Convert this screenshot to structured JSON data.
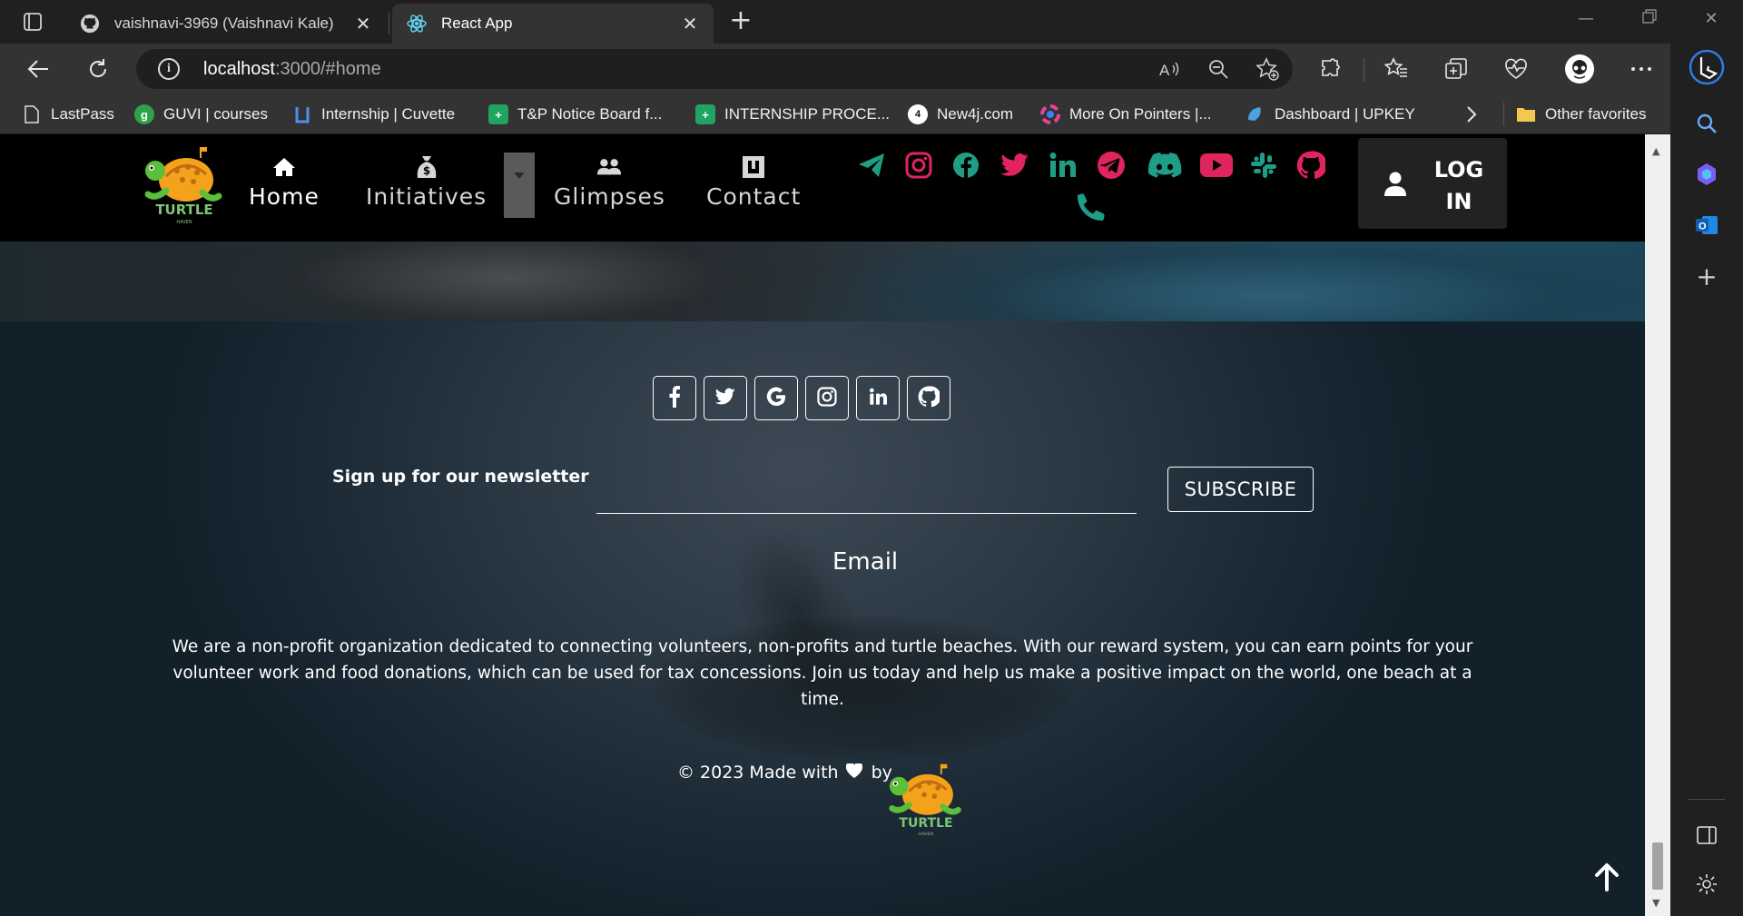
{
  "browser": {
    "tabs": [
      {
        "title": "vaishnavi-3969 (Vaishnavi Kale)",
        "icon": "github-icon",
        "active": false
      },
      {
        "title": "React App",
        "icon": "react-icon",
        "active": true
      }
    ],
    "address": {
      "host": "localhost",
      "path": ":3000/#home"
    },
    "bookmarks": [
      {
        "label": "LastPass",
        "icon": "page-icon"
      },
      {
        "label": "GUVI | courses",
        "icon": "guvi-icon"
      },
      {
        "label": "Internship | Cuvette",
        "icon": "cuvette-icon"
      },
      {
        "label": "T&P Notice Board f...",
        "icon": "plus-sheet-icon"
      },
      {
        "label": "INTERNSHIP PROCE...",
        "icon": "plus-sheet-icon"
      },
      {
        "label": "New4j.com",
        "icon": "new4j-icon"
      },
      {
        "label": "More On Pointers |...",
        "icon": "pointers-icon"
      },
      {
        "label": "Dashboard | UPKEY",
        "icon": "upkey-icon"
      },
      {
        "label": "Other favorites",
        "icon": "folder-icon"
      }
    ]
  },
  "navbar": {
    "items": [
      {
        "label": "Home",
        "icon": "home-icon"
      },
      {
        "label": "Initiatives",
        "icon": "money-bag-icon"
      },
      {
        "label": "Glimpses",
        "icon": "users-icon"
      },
      {
        "label": "Contact",
        "icon": "contact-card-icon"
      }
    ],
    "login_line1": "LOG",
    "login_line2": "IN",
    "brand_color": "#1f9e86"
  },
  "footer": {
    "social_icons": [
      "facebook-icon",
      "twitter-icon",
      "google-icon",
      "instagram-icon",
      "linkedin-icon",
      "github-icon"
    ],
    "newsletter_label": "Sign up for our newsletter",
    "email_value": "",
    "subscribe_label": "SUBSCRIBE",
    "email_label": "Email",
    "about": "We are a non-profit organization dedicated to connecting volunteers, non-profits and turtle beaches. With our reward system, you can earn points for your volunteer work and food donations, which can be used for tax concessions. Join us today and help us make a positive impact on the world, one beach at a time.",
    "credit_prefix": "© 2023 Made with",
    "credit_suffix": "by"
  },
  "logo": {
    "word": "TURTLE",
    "sub": "HAVEN"
  }
}
